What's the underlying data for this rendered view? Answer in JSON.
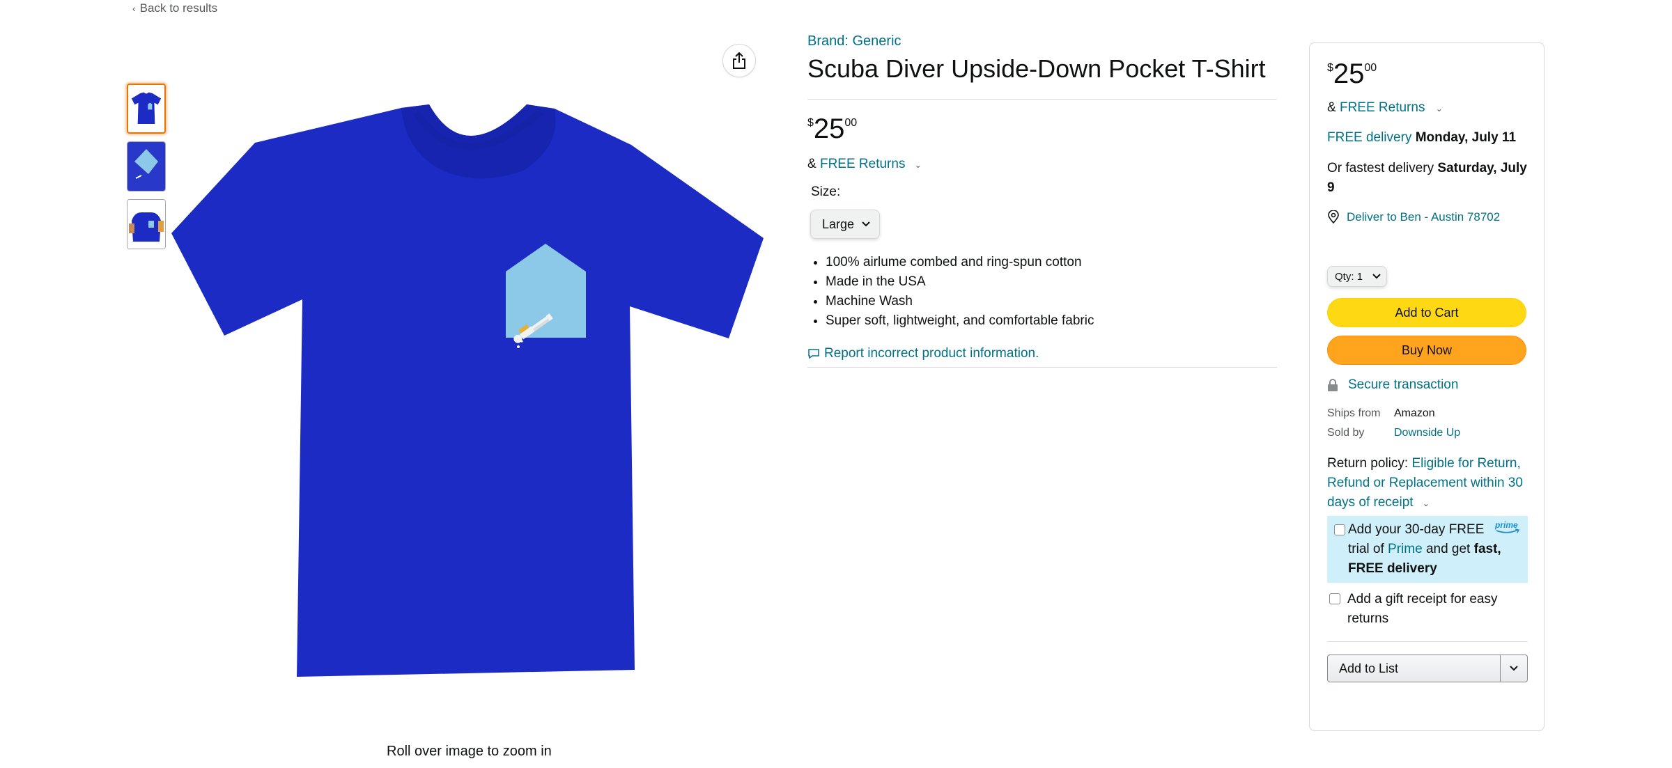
{
  "nav": {
    "back_label": "Back to results"
  },
  "gallery": {
    "thumbnails": [
      "T-shirt front",
      "Pocket detail",
      "Model wearing shirt"
    ],
    "zoom_hint": "Roll over image to zoom in",
    "shirt_color": "#1c2bc4",
    "pocket_color": "#8cc8e8"
  },
  "product": {
    "brand": "Brand: Generic",
    "title": "Scuba Diver Upside-Down Pocket T-Shirt",
    "price": {
      "symbol": "$",
      "whole": "25",
      "fraction": "00"
    },
    "returns_prefix": "&",
    "returns_link": "FREE Returns",
    "size_label": "Size:",
    "size_value": "Large",
    "bullets": [
      "100% airlume combed and ring-spun cotton",
      "Made in the USA",
      "Machine Wash",
      "Super soft, lightweight, and comfortable fabric"
    ],
    "report_link": "Report incorrect product information."
  },
  "buybox": {
    "price": {
      "symbol": "$",
      "whole": "25",
      "fraction": "00"
    },
    "returns_prefix": "&",
    "returns_link": "FREE Returns",
    "delivery_link": "FREE delivery",
    "delivery_date": "Monday, July 11",
    "fastest_prefix": "Or fastest delivery",
    "fastest_date": "Saturday, July 9",
    "deliver_to": "Deliver to Ben - Austin 78702",
    "qty_label": "Qty:",
    "qty_value": "1",
    "add_to_cart": "Add to Cart",
    "buy_now": "Buy Now",
    "secure": "Secure transaction",
    "ships_from_label": "Ships from",
    "ships_from_value": "Amazon",
    "sold_by_label": "Sold by",
    "sold_by_value": "Downside Up",
    "return_policy_label": "Return policy:",
    "return_policy_link": "Eligible for Return, Refund or Replacement within 30 days of receipt",
    "prime_text_1": "Add your 30-day FREE trial of",
    "prime_link": "Prime",
    "prime_text_2": "and get",
    "prime_bold": "fast, FREE delivery",
    "prime_logo": "prime",
    "gift_text": "Add a gift receipt for easy returns",
    "add_to_list": "Add to List"
  },
  "colors": {
    "link": "#007185",
    "cart_button": "#ffd814",
    "buy_button": "#ffa41c",
    "prime_bg": "#cff0fa",
    "selected_thumb": "#e77600"
  }
}
